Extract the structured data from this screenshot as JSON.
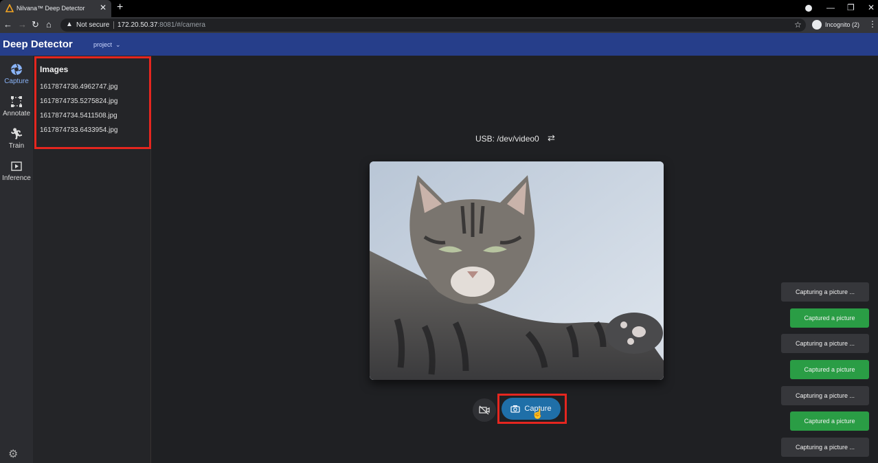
{
  "browser": {
    "tab_title": "Nilvana™ Deep Detector",
    "not_secure": "Not secure",
    "url_host": "172.20.50.37",
    "url_rest": ":8081/#/camera",
    "incognito": "Incognito (2)"
  },
  "app": {
    "brand": "Deep Detector",
    "project_label": "project"
  },
  "nav": {
    "items": [
      {
        "label": "Capture",
        "icon": "aperture-icon"
      },
      {
        "label": "Annotate",
        "icon": "bounding-box-icon"
      },
      {
        "label": "Train",
        "icon": "run-icon"
      },
      {
        "label": "Inference",
        "icon": "play-frame-icon"
      }
    ]
  },
  "images": {
    "title": "Images",
    "files": [
      "1617874736.4962747.jpg",
      "1617874735.5275824.jpg",
      "1617874734.5411508.jpg",
      "1617874733.6433954.jpg"
    ]
  },
  "camera": {
    "source": "USB: /dev/video0",
    "capture_label": "Capture"
  },
  "toasts": [
    {
      "text": "Capturing a picture ...",
      "status": "info"
    },
    {
      "text": "Captured a picture",
      "status": "success"
    },
    {
      "text": "Capturing a picture ...",
      "status": "info"
    },
    {
      "text": "Captured a picture",
      "status": "success"
    },
    {
      "text": "Capturing a picture ...",
      "status": "info"
    },
    {
      "text": "Captured a picture",
      "status": "success"
    },
    {
      "text": "Capturing a picture ...",
      "status": "info"
    }
  ],
  "colors": {
    "header": "#263e8a",
    "success": "#2a9d45",
    "highlight": "#e5261f",
    "capture_button": "#1f6fa8"
  }
}
